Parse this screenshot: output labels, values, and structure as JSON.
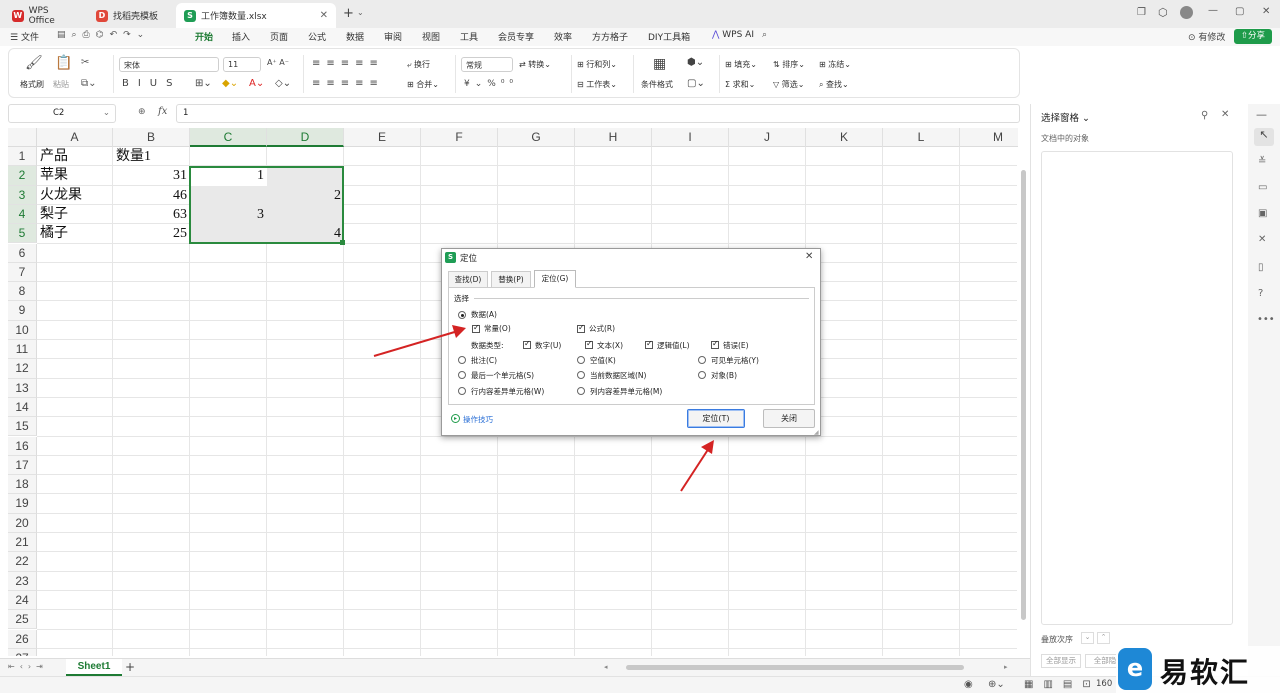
{
  "tabs": [
    {
      "label": "WPS Office",
      "icon": "wps-logo-icon",
      "color": "#d62b2b"
    },
    {
      "label": "找稻壳模板",
      "icon": "docer-icon",
      "color": "#e0483a"
    },
    {
      "label": "工作簿数量.xlsx",
      "icon": "spreadsheet-icon",
      "color": "#1f9d55"
    }
  ],
  "menu": {
    "file": "文件",
    "items": [
      "开始",
      "插入",
      "页面",
      "公式",
      "数据",
      "审阅",
      "视图",
      "工具",
      "会员专享",
      "效率",
      "方方格子",
      "DIY工具箱",
      "WPS AI"
    ],
    "active": "开始",
    "modified": "有修改",
    "share": "分享"
  },
  "ribbon": {
    "format_painter": "格式刷",
    "paste": "粘贴",
    "font_name": "宋体",
    "font_size": "11",
    "wrap": "换行",
    "merge": "合并",
    "number_format": "常规",
    "convert": "转换",
    "row_col": "行和列",
    "worksheet": "工作表",
    "cond_format": "条件格式",
    "fill": "填充",
    "sort": "排序",
    "freeze": "冻结",
    "sum": "求和",
    "filter": "筛选",
    "find": "查找"
  },
  "formula_bar": {
    "name_box": "C2",
    "fx": "fx",
    "value": "1"
  },
  "columns": [
    "A",
    "B",
    "C",
    "D",
    "E",
    "F",
    "G",
    "H",
    "I",
    "J",
    "K",
    "L",
    "M"
  ],
  "rows": [
    "1",
    "2",
    "3",
    "4",
    "5",
    "6",
    "7",
    "8",
    "9",
    "10",
    "11",
    "12",
    "13",
    "14",
    "15",
    "16",
    "17",
    "18",
    "19",
    "20",
    "21",
    "22",
    "23",
    "24",
    "25",
    "26",
    "27"
  ],
  "cells": {
    "A1": "产品",
    "B1": "数量1",
    "A2": "苹果",
    "B2": "31",
    "C2": "1",
    "A3": "火龙果",
    "B3": "46",
    "D3": "2",
    "A4": "梨子",
    "B4": "63",
    "C4": "3",
    "A5": "橘子",
    "B5": "25",
    "D5": "4"
  },
  "sheets": [
    "Sheet1"
  ],
  "panel": {
    "title": "选择窗格",
    "subtitle": "文档中的对象",
    "order": "叠放次序",
    "show_all": "全部显示",
    "hide_all": "全部隐"
  },
  "status": {
    "zoom": "160"
  },
  "dialog": {
    "title": "定位",
    "tabs": [
      "查找(D)",
      "替换(P)",
      "定位(G)"
    ],
    "active_tab": "定位(G)",
    "group": "选择",
    "data": "数据(A)",
    "constant": "常量(O)",
    "formula": "公式(R)",
    "data_type": "数据类型:",
    "number": "数字(U)",
    "text": "文本(X)",
    "logical": "逻辑值(L)",
    "error": "错误(E)",
    "comment": "批注(C)",
    "blank": "空值(K)",
    "visible": "可见单元格(Y)",
    "last_cell": "最后一个单元格(S)",
    "current_region": "当前数据区域(N)",
    "object": "对象(B)",
    "row_diff": "行内容差异单元格(W)",
    "col_diff": "列内容差异单元格(M)",
    "tips": "操作技巧",
    "locate_button": "定位(T)",
    "close_button": "关闭"
  },
  "watermark": "易软汇",
  "accent": "#1e7b34",
  "arrow_color": "#d42323"
}
